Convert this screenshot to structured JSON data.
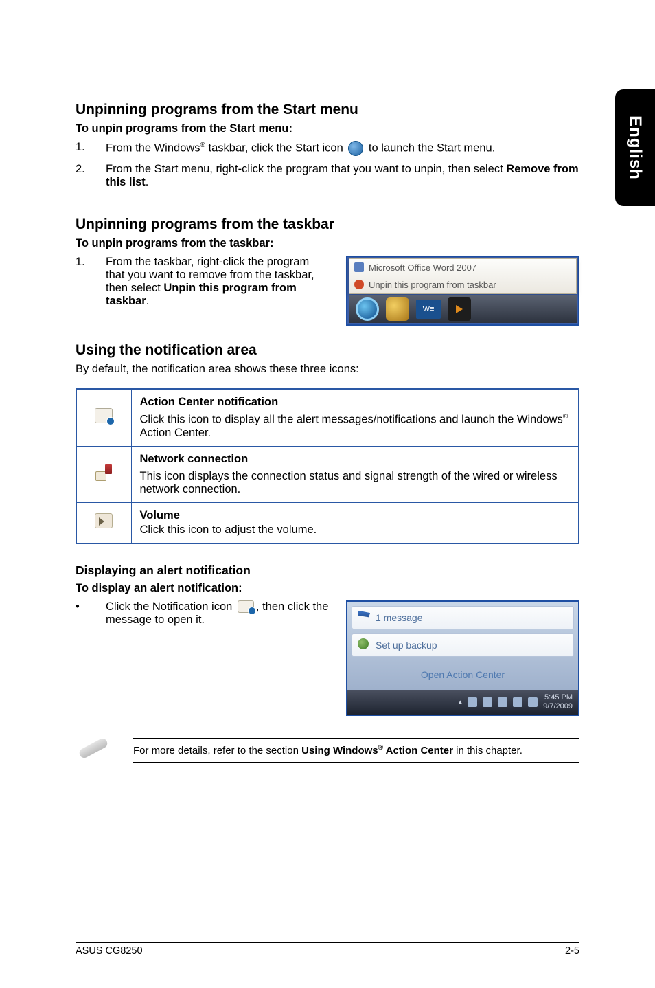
{
  "sideTab": "English",
  "s1": {
    "title": "Unpinning programs from the Start menu",
    "sub": "To unpin programs from the Start menu:",
    "step1_a": "From the Windows",
    "step1_b": " taskbar, click the Start icon ",
    "step1_c": " to launch the Start menu.",
    "step2_a": "From the Start menu, right-click the program that you want to unpin, then select ",
    "step2_bold": "Remove from this list",
    "step2_c": "."
  },
  "s2": {
    "title": "Unpinning programs from the taskbar",
    "sub": "To unpin programs from the taskbar:",
    "step1_a": "From the taskbar, right-click the program that you want to remove from the taskbar, then select ",
    "step1_bold": "Unpin this program from taskbar",
    "step1_c": ".",
    "popup_line1": "Microsoft Office Word 2007",
    "popup_line2": "Unpin this program from taskbar"
  },
  "s3": {
    "title": "Using the notification area",
    "body": "By default, the notification area shows these three icons:",
    "r1_title": "Action Center notification",
    "r1_body_a": "Click this icon to display all the alert messages/notifications and launch the Windows",
    "r1_body_b": " Action Center.",
    "r2_title": "Network connection",
    "r2_body": "This icon displays the connection status and signal strength of the wired or wireless network connection.",
    "r3_title": "Volume",
    "r3_body": "Click this icon to adjust the volume."
  },
  "s4": {
    "title": "Displaying an alert notification",
    "sub": "To display an alert notification:",
    "bullet_a": "Click the Notification icon ",
    "bullet_b": ", then click the message to open it.",
    "ac_msg": "1 message",
    "ac_opt": "Set up backup",
    "ac_open": "Open Action Center",
    "ac_time": "5:45 PM",
    "ac_date": "9/7/2009"
  },
  "note_a": "For more details, refer to the section ",
  "note_bold_a": "Using Windows",
  "note_bold_b": " Action Center",
  "note_c": " in this chapter.",
  "footer_left": "ASUS CG8250",
  "footer_right": "2-5"
}
